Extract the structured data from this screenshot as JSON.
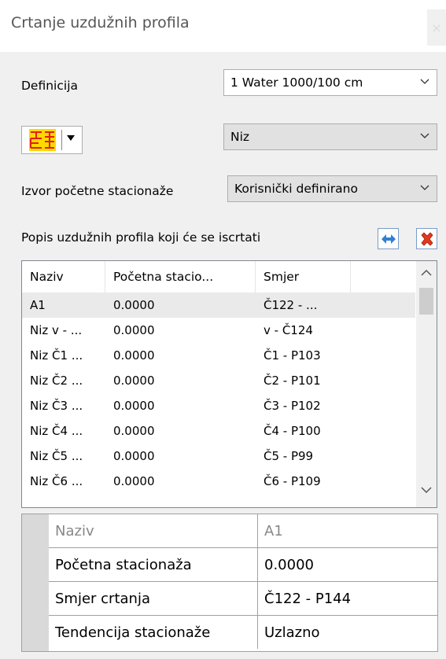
{
  "window": {
    "title": "Crtanje uzdužnih profila",
    "close_glyph": "×"
  },
  "definicija": {
    "label": "Definicija",
    "value": "1 Water 1000/100 cm"
  },
  "direction": {
    "value": "Niz"
  },
  "izvor": {
    "label": "Izvor početne stacionaže",
    "value": "Korisnički definirano"
  },
  "list": {
    "label": "Popis uzdužnih profila koji će se iscrtati",
    "columns": [
      "Naziv",
      "Početna stacio...",
      "Smjer"
    ],
    "rows": [
      {
        "naziv": "A1",
        "pocetna": "0.0000",
        "smjer": "Č122 - ..."
      },
      {
        "naziv": "Niz v - ...",
        "pocetna": "0.0000",
        "smjer": "v - Č124"
      },
      {
        "naziv": "Niz Č1 ...",
        "pocetna": "0.0000",
        "smjer": "Č1 - P103"
      },
      {
        "naziv": "Niz Č2 ...",
        "pocetna": "0.0000",
        "smjer": "Č2 - P101"
      },
      {
        "naziv": "Niz Č3 ...",
        "pocetna": "0.0000",
        "smjer": "Č3 - P102"
      },
      {
        "naziv": "Niz Č4 ...",
        "pocetna": "0.0000",
        "smjer": "Č4 - P100"
      },
      {
        "naziv": "Niz Č5 ...",
        "pocetna": "0.0000",
        "smjer": "Č5 - P99"
      },
      {
        "naziv": "Niz Č6 ...",
        "pocetna": "0.0000",
        "smjer": "Č6 - P109"
      }
    ]
  },
  "properties": [
    {
      "key": "Naziv",
      "value": "A1"
    },
    {
      "key": "Početna stacionaža",
      "value": "0.0000"
    },
    {
      "key": "Smjer crtanja",
      "value": "Č122 - P144"
    },
    {
      "key": "Tendencija stacionaže",
      "value": "Uzlazno"
    }
  ],
  "colors": {
    "accent": "#2f7fd6",
    "delete": "#e03a1e",
    "icon": "#ffd800"
  }
}
